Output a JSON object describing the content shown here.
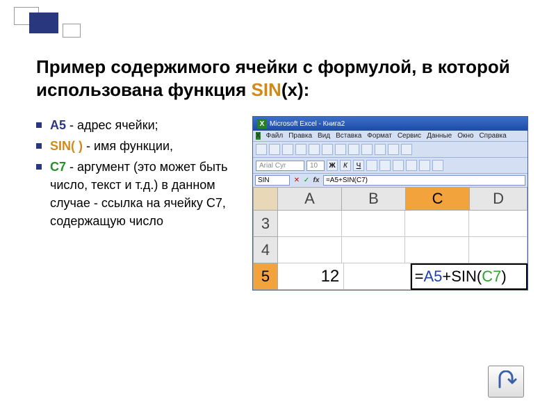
{
  "title_prefix": "Пример содержимого ячейки с формулой, в которой использована функция ",
  "title_fn": "SIN",
  "title_arg": "(x):",
  "bullets": {
    "a5": {
      "key": "А5",
      "rest": " - адрес ячейки;"
    },
    "sin": {
      "key": "SIN( )",
      "rest": " - имя функции,"
    },
    "c7": {
      "key": "С7",
      "rest": " - аргумент (это может быть число, текст и т.д.) в данном случае - ссылка на ячейку С7, содержащую число"
    }
  },
  "excel": {
    "title": "Microsoft Excel - Книга2",
    "menu": [
      "Файл",
      "Правка",
      "Вид",
      "Вставка",
      "Формат",
      "Сервис",
      "Данные",
      "Окно",
      "Справка"
    ],
    "fontbox": "Arial Cyr",
    "sizebox": "10",
    "namebox": "SIN",
    "formula": "=A5+SIN(C7)",
    "fx": "fx",
    "cols": [
      "A",
      "B",
      "C",
      "D"
    ],
    "rows": [
      "3",
      "4",
      "5"
    ],
    "a5_val": "12",
    "editing_eq": "=",
    "editing_a5": "A5",
    "editing_plus": "+",
    "editing_sin": "SIN",
    "editing_open": "(",
    "editing_c7": "C7",
    "editing_close": ")"
  }
}
